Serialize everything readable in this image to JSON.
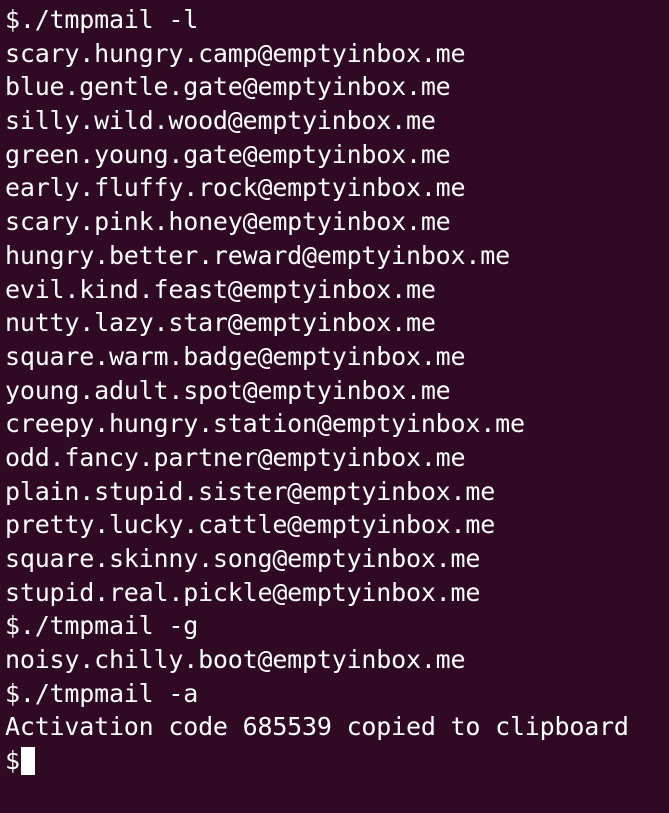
{
  "terminal": {
    "lines": [
      "$./tmpmail -l",
      "scary.hungry.camp@emptyinbox.me",
      "blue.gentle.gate@emptyinbox.me",
      "silly.wild.wood@emptyinbox.me",
      "green.young.gate@emptyinbox.me",
      "early.fluffy.rock@emptyinbox.me",
      "scary.pink.honey@emptyinbox.me",
      "hungry.better.reward@emptyinbox.me",
      "evil.kind.feast@emptyinbox.me",
      "nutty.lazy.star@emptyinbox.me",
      "square.warm.badge@emptyinbox.me",
      "young.adult.spot@emptyinbox.me",
      "creepy.hungry.station@emptyinbox.me",
      "odd.fancy.partner@emptyinbox.me",
      "plain.stupid.sister@emptyinbox.me",
      "pretty.lucky.cattle@emptyinbox.me",
      "square.skinny.song@emptyinbox.me",
      "stupid.real.pickle@emptyinbox.me",
      "$./tmpmail -g",
      "noisy.chilly.boot@emptyinbox.me",
      "$./tmpmail -a",
      "Activation code 685539 copied to clipboard"
    ],
    "prompt": "$"
  }
}
